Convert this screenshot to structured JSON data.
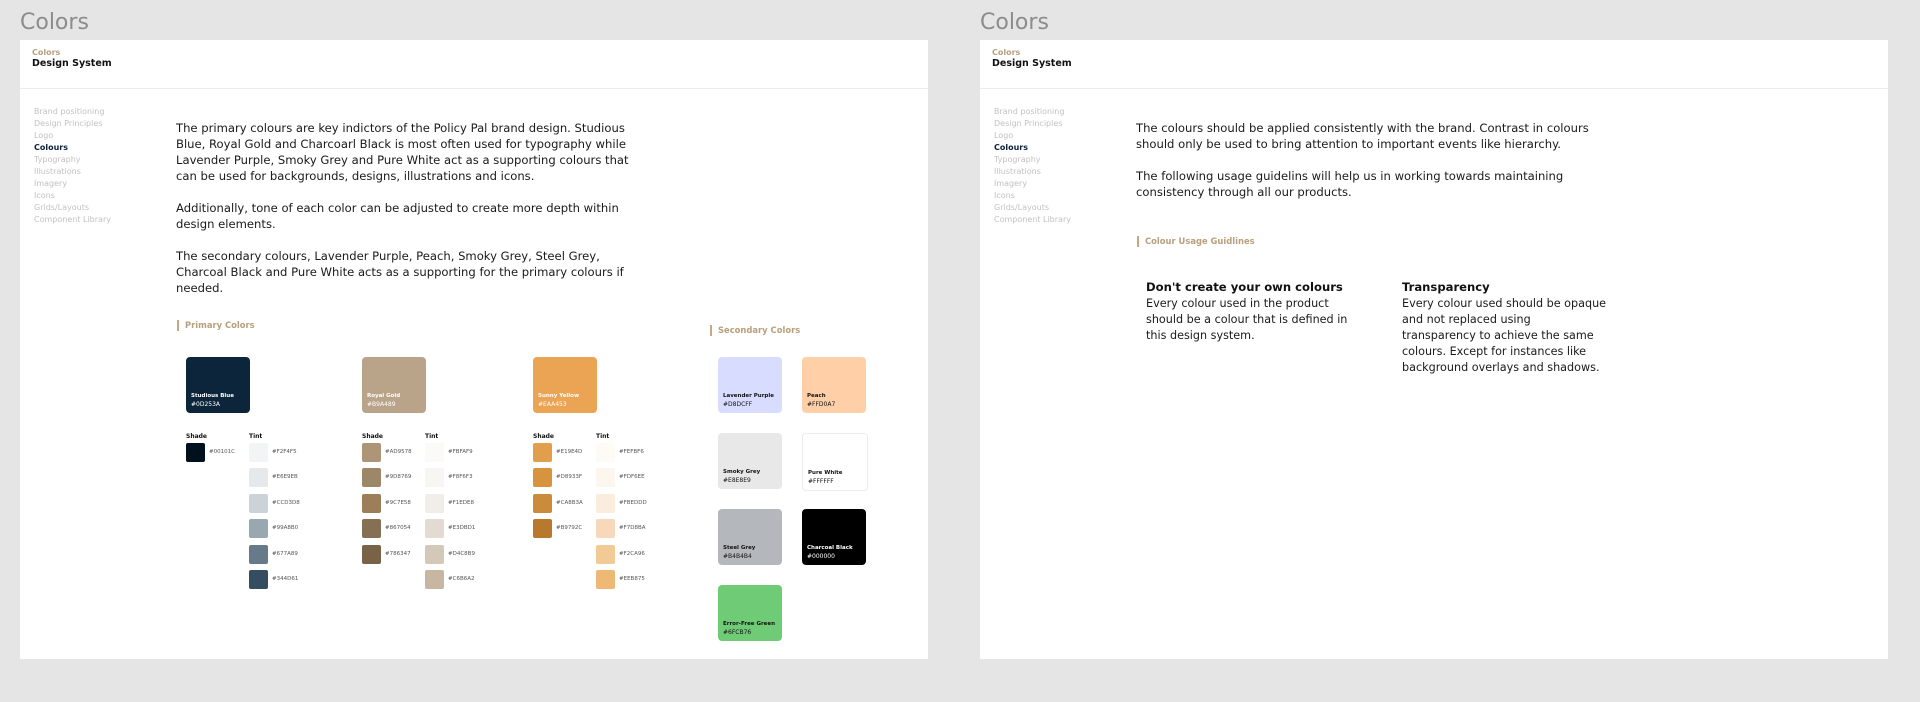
{
  "left": {
    "frame_title": "Colors",
    "crumb": "Colors",
    "section_title": "Design System",
    "nav": [
      "Brand positioning",
      "Design Principles",
      "Logo",
      "Colours",
      "Typography",
      "Illustrations",
      "Imagery",
      "Icons",
      "Grids/Layouts",
      "Component Library"
    ],
    "active_nav": "Colours",
    "paragraphs": [
      "The primary colours are key indictors of the Policy Pal brand design. Studious Blue, Royal Gold and Charcoarl Black is most often used for typography while Lavender Purple, Smoky Grey and Pure White act as a supporting colours that can be used for backgrounds, designs, illustrations and icons.",
      "Additionally, tone of each color can be adjusted to create more depth within design elements.",
      "The secondary colours, Lavender Purple, Peach, Smoky Grey, Steel Grey, Charcoal Black and Pure White acts as a supporting for the primary colours if needed."
    ],
    "primary_label": "Primary Colors",
    "secondary_label": "Secondary Colors",
    "shade_label": "Shade",
    "tint_label": "Tint",
    "primary": [
      {
        "name": "Studious Blue",
        "hex": "#0D253A",
        "color": "#0d253a",
        "text_color": "#ffffff",
        "shades": [
          "#00101C"
        ],
        "tints": [
          "#F2F4F5",
          "#E6E9EB",
          "#CCD3D8",
          "#99A8B0",
          "#677A89",
          "#344D61"
        ]
      },
      {
        "name": "Royal Gold",
        "hex": "#B9A489",
        "color": "#b9a489",
        "text_color": "#ffffff",
        "shades": [
          "#AD9578",
          "#9D8769",
          "#9C7E58",
          "#867054",
          "#786347"
        ],
        "tints": [
          "#FBFAF9",
          "#F8F6F3",
          "#F1EDE8",
          "#E3DBD1",
          "#D4C8B9",
          "#C6B6A2"
        ]
      },
      {
        "name": "Sunny Yellow",
        "hex": "#EAA453",
        "color": "#eaa453",
        "text_color": "#ffffff",
        "shades": [
          "#E19E4D",
          "#D8933F",
          "#CA8B3A",
          "#B9792C"
        ],
        "tints": [
          "#FEFBF6",
          "#FDF6EE",
          "#FBEDDD",
          "#F7D8BA",
          "#F2CA96",
          "#EEB875"
        ]
      }
    ],
    "secondary": [
      {
        "name": "Lavender Purple",
        "hex": "#D8DCFF",
        "color": "#d8dcff",
        "text_color": "#111111"
      },
      {
        "name": "Peach",
        "hex": "#FFD0A7",
        "color": "#ffd0a7",
        "text_color": "#111111"
      },
      {
        "name": "Smoky Grey",
        "hex": "#E8E8E9",
        "color": "#e8e8e9",
        "text_color": "#111111"
      },
      {
        "name": "Pure White",
        "hex": "#FFFFFF",
        "color": "#ffffff",
        "text_color": "#111111"
      },
      {
        "name": "Steel Grey",
        "hex": "#B4B4B4",
        "color": "#b4b8bc",
        "text_color": "#111111"
      },
      {
        "name": "Charcoal Black",
        "hex": "#000000",
        "color": "#000000",
        "text_color": "#ffffff"
      },
      {
        "name": "Error-Free Green",
        "hex": "#6FCB76",
        "color": "#6fcb76",
        "text_color": "#111111"
      }
    ]
  },
  "right": {
    "frame_title": "Colors",
    "crumb": "Colors",
    "section_title": "Design System",
    "nav": [
      "Brand positioning",
      "Design Principles",
      "Logo",
      "Colours",
      "Typography",
      "Illustrations",
      "Imagery",
      "Icons",
      "Grids/Layouts",
      "Component Library"
    ],
    "paragraphs": [
      "The colours should be applied consistently with the brand. Contrast in colours should only be used to bring attention to important events like hierarchy.",
      "The following usage guidelins will help us in working towards maintaining consistency through all our products."
    ],
    "guide_label": "Colour Usage Guidlines",
    "guides": [
      {
        "title": "Don't create your own colours",
        "text": "Every colour used in the product should be a colour that is defined in this design system."
      },
      {
        "title": "Transparency",
        "text": "Every colour used should be opaque and not replaced using transparency to achieve the same colours. Except for instances like background overlays and shadows."
      }
    ]
  }
}
